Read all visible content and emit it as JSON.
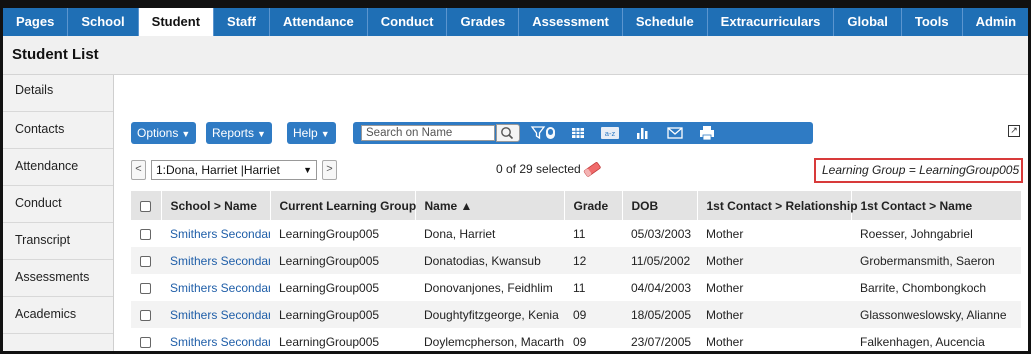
{
  "topnav": {
    "tabs": [
      {
        "label": "Pages",
        "active": false
      },
      {
        "label": "School",
        "active": false
      },
      {
        "label": "Student",
        "active": true
      },
      {
        "label": "Staff",
        "active": false
      },
      {
        "label": "Attendance",
        "active": false
      },
      {
        "label": "Conduct",
        "active": false
      },
      {
        "label": "Grades",
        "active": false
      },
      {
        "label": "Assessment",
        "active": false
      },
      {
        "label": "Schedule",
        "active": false
      },
      {
        "label": "Extracurriculars",
        "active": false
      },
      {
        "label": "Global",
        "active": false
      },
      {
        "label": "Tools",
        "active": false
      },
      {
        "label": "Admin",
        "active": false
      }
    ]
  },
  "page": {
    "title": "Student List"
  },
  "sidenav": {
    "items": [
      "Details",
      "Contacts",
      "Attendance",
      "Conduct",
      "Transcript",
      "Assessments",
      "Academics"
    ]
  },
  "toolbar": {
    "options_label": "Options",
    "reports_label": "Reports",
    "help_label": "Help",
    "search_placeholder": "Search on Name",
    "icons": [
      "search-icon",
      "filter-icon",
      "grid-view-icon",
      "sort-icon",
      "chart-icon",
      "email-icon",
      "print-icon",
      "expand-icon"
    ]
  },
  "pager": {
    "prev_label": "<",
    "next_label": ">",
    "current_record": "1:Dona, Harriet |Harriet",
    "selected_text": "0 of 29 selected",
    "filter_text": "Learning Group = LearningGroup005"
  },
  "grid": {
    "columns": [
      "School > Name",
      "Current Learning Group",
      "Name ▲",
      "Grade",
      "DOB",
      "1st Contact > Relationship",
      "1st Contact > Name"
    ],
    "rows": [
      {
        "school": "Smithers Secondary",
        "group": "LearningGroup005",
        "name": "Dona, Harriet",
        "grade": "11",
        "dob": "05/03/2003",
        "relationship": "Mother",
        "contact": "Roesser, Johngabriel"
      },
      {
        "school": "Smithers Secondary",
        "group": "LearningGroup005",
        "name": "Donatodias, Kwansub",
        "grade": "12",
        "dob": "11/05/2002",
        "relationship": "Mother",
        "contact": "Grobermansmith, Saeron"
      },
      {
        "school": "Smithers Secondary",
        "group": "LearningGroup005",
        "name": "Donovanjones, Feidhlim",
        "grade": "11",
        "dob": "04/04/2003",
        "relationship": "Mother",
        "contact": "Barrite, Chombongkoch"
      },
      {
        "school": "Smithers Secondary",
        "group": "LearningGroup005",
        "name": "Doughtyfitzgeorge, Kenia",
        "grade": "09",
        "dob": "18/05/2005",
        "relationship": "Mother",
        "contact": "Glassonweslowsky, Alianne"
      },
      {
        "school": "Smithers Secondary",
        "group": "LearningGroup005",
        "name": "Doylemcpherson, Macarthur",
        "grade": "09",
        "dob": "23/07/2005",
        "relationship": "Mother",
        "contact": "Falkenhagen, Aucencia"
      }
    ]
  }
}
